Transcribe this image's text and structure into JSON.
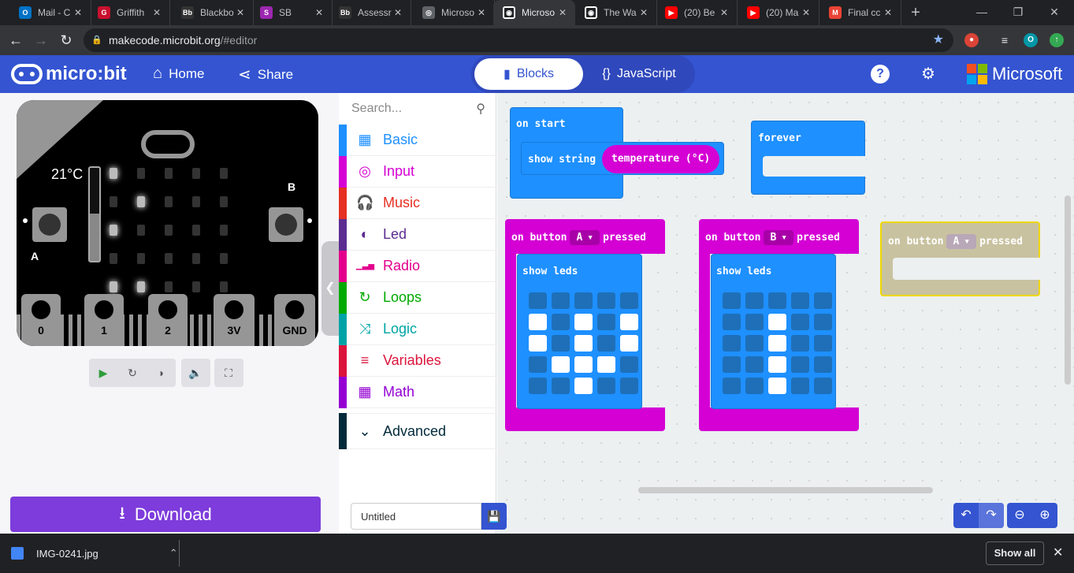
{
  "browser": {
    "tabs": [
      {
        "title": "Mail - C",
        "color": "#0072c6",
        "glyph": "O"
      },
      {
        "title": "Griffith",
        "color": "#c8102e",
        "glyph": "G"
      },
      {
        "title": "Blackbo",
        "color": "#333333",
        "glyph": "Bb"
      },
      {
        "title": "SB",
        "color": "#9c27b0",
        "glyph": "S"
      },
      {
        "title": "Assessr",
        "color": "#333333",
        "glyph": "Bb"
      },
      {
        "title": "Microso",
        "color": "#5f6368",
        "glyph": "◎"
      },
      {
        "title": "Microso",
        "color": "#ffffff",
        "glyph": "◉",
        "active": true
      },
      {
        "title": "The Wa",
        "color": "#ffffff",
        "glyph": "◉"
      },
      {
        "title": "(20) Be",
        "color": "#ff0000",
        "glyph": "▶"
      },
      {
        "title": "(20) Ma",
        "color": "#ff0000",
        "glyph": "▶"
      },
      {
        "title": "Final cc",
        "color": "#ea4335",
        "glyph": "M"
      }
    ],
    "url_host": "makecode.microbit.org",
    "url_path": "/#editor",
    "profile_initial": "O"
  },
  "header": {
    "brand": "micro:bit",
    "home": "Home",
    "share": "Share",
    "mode_blocks": "Blocks",
    "mode_js": "JavaScript",
    "microsoft": "Microsoft"
  },
  "simulator": {
    "temperature": "21°C",
    "pins": [
      "0",
      "1",
      "2",
      "3V",
      "GND"
    ],
    "button_a": "A",
    "button_b": "B"
  },
  "toolbox": {
    "search_placeholder": "Search...",
    "categories": [
      {
        "label": "Basic",
        "color": "#1e90ff",
        "icon": "grid-icon"
      },
      {
        "label": "Input",
        "color": "#d400d4",
        "icon": "target-icon"
      },
      {
        "label": "Music",
        "color": "#e63022",
        "icon": "headphones-icon"
      },
      {
        "label": "Led",
        "color": "#5c2d91",
        "icon": "toggle-icon"
      },
      {
        "label": "Radio",
        "color": "#e3008c",
        "icon": "signal-icon"
      },
      {
        "label": "Loops",
        "color": "#00aa00",
        "icon": "refresh-icon"
      },
      {
        "label": "Logic",
        "color": "#00a4a6",
        "icon": "shuffle-icon"
      },
      {
        "label": "Variables",
        "color": "#dc143c",
        "icon": "list-icon"
      },
      {
        "label": "Math",
        "color": "#9400d3",
        "icon": "calculator-icon"
      }
    ],
    "advanced": "Advanced"
  },
  "workspace": {
    "on_start": "on start",
    "show_string": "show string",
    "temperature_arg": "temperature (°C)",
    "forever": "forever",
    "on_button": "on button",
    "pressed": "pressed",
    "show_leds": "show leds",
    "button_a": "A",
    "button_b": "B",
    "leds_a": [
      0,
      0,
      0,
      0,
      0,
      1,
      0,
      1,
      0,
      1,
      1,
      0,
      1,
      0,
      1,
      0,
      1,
      1,
      1,
      0,
      0,
      0,
      1,
      0,
      0
    ],
    "leds_b": [
      0,
      0,
      0,
      0,
      0,
      0,
      0,
      1,
      0,
      0,
      0,
      0,
      1,
      0,
      0,
      0,
      0,
      1,
      0,
      0,
      0,
      0,
      1,
      0,
      0
    ]
  },
  "bottom": {
    "download": "Download",
    "project_name": "Untitled"
  },
  "shelf": {
    "file": "IMG-0241.jpg",
    "show_all": "Show all"
  },
  "colors": {
    "header": "#3454d1",
    "block_blue": "#1e90ff",
    "block_magenta": "#d400d4",
    "download": "#7d3cdb"
  }
}
